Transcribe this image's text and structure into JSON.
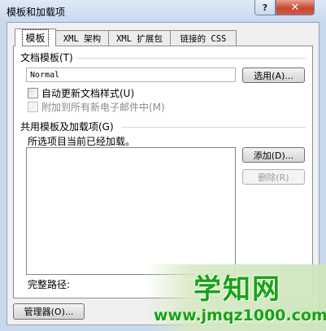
{
  "window": {
    "title": "模板和加载项",
    "help_label": "?",
    "close_label": "✕"
  },
  "tabs": [
    {
      "label": "模板"
    },
    {
      "label": "XML 架构"
    },
    {
      "label": "XML 扩展包"
    },
    {
      "label": "链接的 CSS"
    }
  ],
  "document_template": {
    "heading": "文档模板(T)",
    "value": "Normal",
    "attach_button": "选用(A)...",
    "auto_update_label": "自动更新文档样式(U)",
    "attach_email_label": "附加到所有新电子邮件中(M)"
  },
  "global_templates": {
    "heading": "共用模板及加载项(G)",
    "info": "所选项目当前已经加载。",
    "add_button": "添加(D)...",
    "remove_button": "删除(R)",
    "full_path_label": "完整路径:"
  },
  "footer": {
    "organizer_button": "管理器(O)..."
  },
  "watermark": {
    "title": "学知网",
    "url": "www.jmqz1000.com"
  }
}
